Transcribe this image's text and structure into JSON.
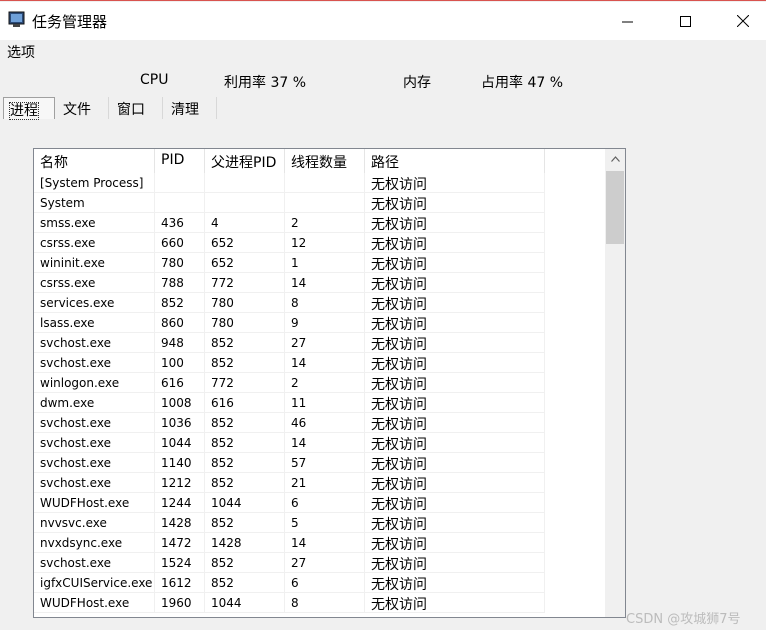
{
  "window": {
    "title": "任务管理器",
    "controls": {
      "minimize": "minimize",
      "maximize": "maximize",
      "close": "close"
    }
  },
  "menu": {
    "options": "选项"
  },
  "stats": {
    "cpu_label": "CPU",
    "cpu_usage": "利用率 37 %",
    "mem_label": "内存",
    "mem_usage": "占用率 47 %"
  },
  "tabs": [
    {
      "label": "进程",
      "active": true
    },
    {
      "label": "文件",
      "active": false
    },
    {
      "label": "窗口",
      "active": false
    },
    {
      "label": "清理",
      "active": false
    }
  ],
  "table": {
    "columns": [
      "名称",
      "PID",
      "父进程PID",
      "线程数量",
      "路径"
    ],
    "rows": [
      [
        "[System Process]",
        "",
        "",
        "",
        "无权访问"
      ],
      [
        "System",
        "",
        "",
        "",
        "无权访问"
      ],
      [
        "smss.exe",
        "436",
        "4",
        "2",
        "无权访问"
      ],
      [
        "csrss.exe",
        "660",
        "652",
        "12",
        "无权访问"
      ],
      [
        "wininit.exe",
        "780",
        "652",
        "1",
        "无权访问"
      ],
      [
        "csrss.exe",
        "788",
        "772",
        "14",
        "无权访问"
      ],
      [
        "services.exe",
        "852",
        "780",
        "8",
        "无权访问"
      ],
      [
        "lsass.exe",
        "860",
        "780",
        "9",
        "无权访问"
      ],
      [
        "svchost.exe",
        "948",
        "852",
        "27",
        "无权访问"
      ],
      [
        "svchost.exe",
        "100",
        "852",
        "14",
        "无权访问"
      ],
      [
        "winlogon.exe",
        "616",
        "772",
        "2",
        "无权访问"
      ],
      [
        "dwm.exe",
        "1008",
        "616",
        "11",
        "无权访问"
      ],
      [
        "svchost.exe",
        "1036",
        "852",
        "46",
        "无权访问"
      ],
      [
        "svchost.exe",
        "1044",
        "852",
        "14",
        "无权访问"
      ],
      [
        "svchost.exe",
        "1140",
        "852",
        "57",
        "无权访问"
      ],
      [
        "svchost.exe",
        "1212",
        "852",
        "21",
        "无权访问"
      ],
      [
        "WUDFHost.exe",
        "1244",
        "1044",
        "6",
        "无权访问"
      ],
      [
        "nvvsvc.exe",
        "1428",
        "852",
        "5",
        "无权访问"
      ],
      [
        "nvxdsync.exe",
        "1472",
        "1428",
        "14",
        "无权访问"
      ],
      [
        "svchost.exe",
        "1524",
        "852",
        "27",
        "无权访问"
      ],
      [
        "igfxCUIService.exe",
        "1612",
        "852",
        "6",
        "无权访问"
      ],
      [
        "WUDFHost.exe",
        "1960",
        "1044",
        "8",
        "无权访问"
      ]
    ]
  },
  "watermark": "CSDN @攻城狮7号"
}
